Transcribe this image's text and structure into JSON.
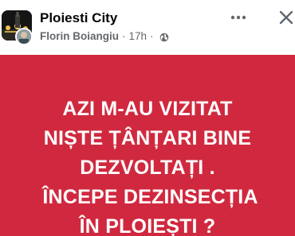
{
  "post": {
    "group_name": "Ploiesti City",
    "author": "Florin Boiangiu",
    "time": "17h",
    "separator": "·",
    "privacy_icon": "globe-icon",
    "more_icon": "more-options-icon",
    "close_icon": "close-icon"
  },
  "card": {
    "background_color": "#d0293f",
    "text_color": "#ffffff",
    "lines": [
      "AZI M-AU VIZITAT",
      "NIȘTE ȚÂNȚARI BINE",
      "DEZVOLTAȚI .",
      " ÎNCEPE DEZINSECȚIA",
      "ÎN PLOIEȘTI ?"
    ]
  }
}
